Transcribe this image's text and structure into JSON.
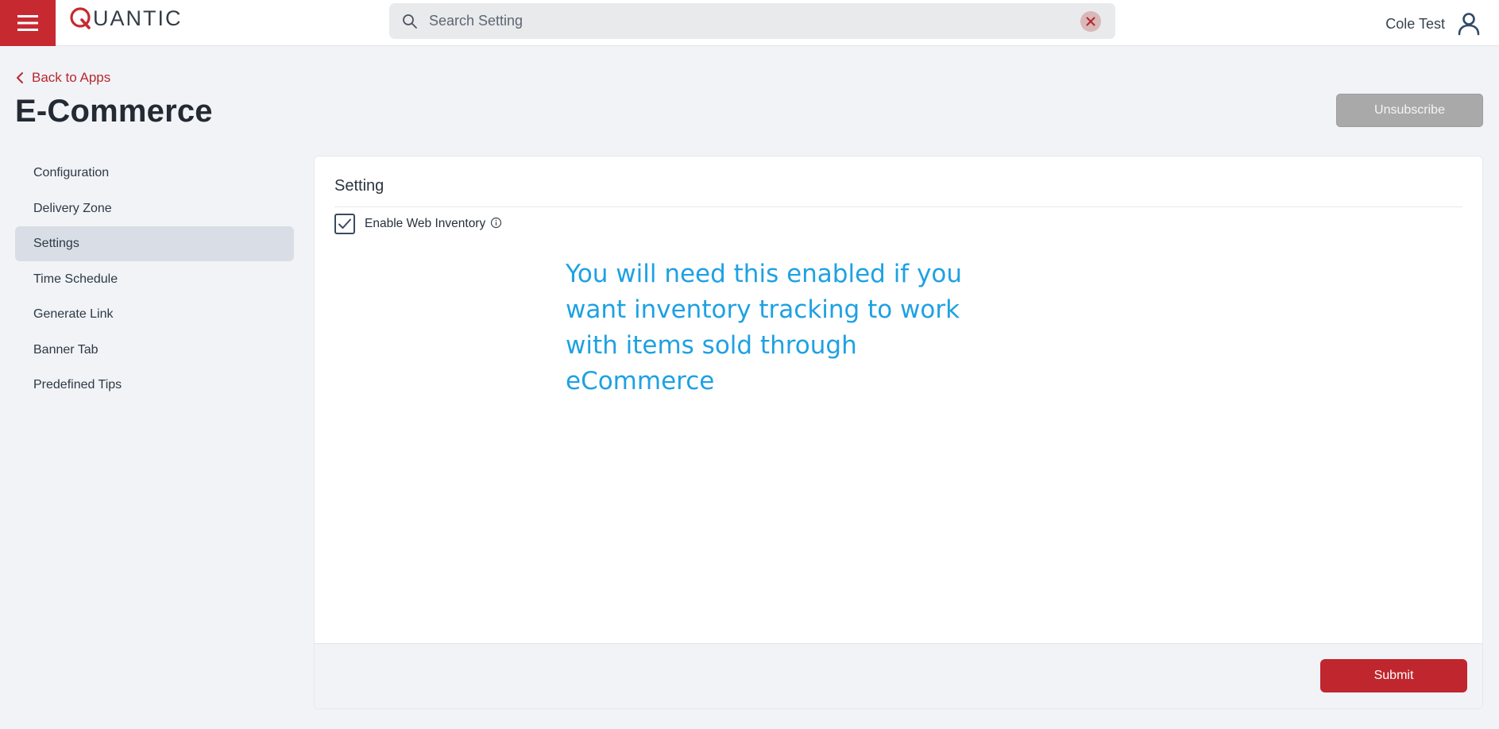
{
  "header": {
    "logo_text": "UANTIC",
    "logo_letter": "Q",
    "brand_color": "#c62a30",
    "search": {
      "placeholder": "Search Setting",
      "value": ""
    },
    "user": {
      "name": "Cole Test"
    }
  },
  "page": {
    "back_label": "Back to Apps",
    "title": "E-Commerce",
    "unsubscribe_label": "Unsubscribe"
  },
  "sidebar": {
    "items": [
      {
        "label": "Configuration",
        "active": false
      },
      {
        "label": "Delivery Zone",
        "active": false
      },
      {
        "label": "Settings",
        "active": true
      },
      {
        "label": "Time Schedule",
        "active": false
      },
      {
        "label": "Generate Link",
        "active": false
      },
      {
        "label": "Banner Tab",
        "active": false
      },
      {
        "label": "Predefined Tips",
        "active": false
      }
    ]
  },
  "card": {
    "title": "Setting",
    "checkbox": {
      "label": "Enable Web Inventory",
      "checked": true
    },
    "annotation": "You will need this enabled if you want inventory tracking to work with items sold through eCommerce",
    "submit_label": "Submit"
  },
  "icons": {
    "menu": "hamburger-menu-icon",
    "search": "search-icon",
    "clear": "close-icon",
    "user": "user-icon",
    "back": "chevron-left-icon",
    "info": "info-icon",
    "check": "checkmark-icon"
  }
}
